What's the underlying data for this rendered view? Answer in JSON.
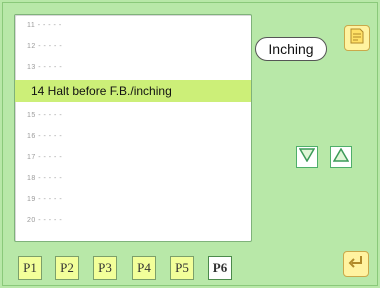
{
  "list": {
    "rows": [
      {
        "label": "11 - - - - -",
        "state": "faded"
      },
      {
        "label": "12 - - - - -",
        "state": "faded"
      },
      {
        "label": "13 - - - - -",
        "state": "faded"
      },
      {
        "label": "14 Halt before F.B./inching",
        "state": "selected"
      },
      {
        "label": "15 - - - - -",
        "state": "faded"
      },
      {
        "label": "16 - - - - -",
        "state": "faded"
      },
      {
        "label": "17 - - - - -",
        "state": "faded"
      },
      {
        "label": "18 - - - - -",
        "state": "faded"
      },
      {
        "label": "19 - - - - -",
        "state": "faded"
      },
      {
        "label": "20 - - - - -",
        "state": "faded"
      }
    ]
  },
  "inching_button": {
    "label": "Inching"
  },
  "tabs": [
    {
      "label": "P1"
    },
    {
      "label": "P2"
    },
    {
      "label": "P3"
    },
    {
      "label": "P4"
    },
    {
      "label": "P5"
    },
    {
      "label": "P6",
      "active": true
    }
  ],
  "icons": {
    "corner_top": "document-icon",
    "corner_bottom": "return-icon",
    "down": "triangle-down-icon",
    "up": "triangle-up-icon"
  },
  "colors": {
    "background": "#b8e8a8",
    "selected_row": "#ccef78",
    "tab": "#f2ff9a",
    "arrow": "#4fae6a"
  }
}
